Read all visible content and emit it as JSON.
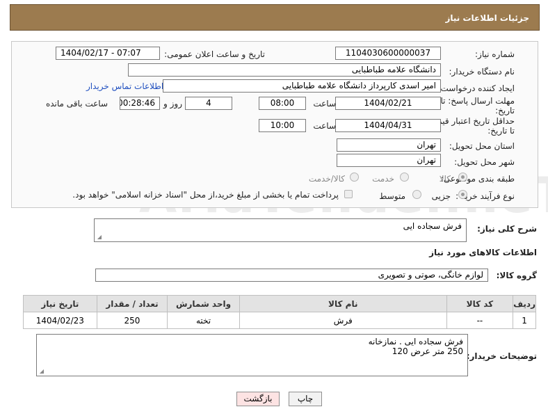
{
  "header": {
    "title": "جزئیات اطلاعات نیاز"
  },
  "form": {
    "need_number_label": "شماره نیاز:",
    "need_number": "1104030600000037",
    "announce_label": "تاریخ و ساعت اعلان عمومی:",
    "announce_value": "1404/02/17 - 07:07",
    "buyer_org_label": "نام دستگاه خریدار:",
    "buyer_org": "دانشگاه علامه طباطبایی",
    "requester_label": "ایجاد کننده درخواست:",
    "requester": "امیر اسدی کارپرداز دانشگاه علامه طباطبایی",
    "contact_link": "اطلاعات تماس خریدار",
    "deadline_label_1": "مهلت ارسال پاسخ: تا",
    "deadline_label_2": "تاریخ:",
    "deadline_date": "1404/02/21",
    "time_label": "ساعت",
    "deadline_time": "08:00",
    "days": "4",
    "days_label": "روز و",
    "remaining": "00:28:46",
    "remaining_label": "ساعت باقی مانده",
    "validity_label_1": "حداقل تاریخ اعتبار قیمت:",
    "validity_label_2": "تا تاریخ:",
    "validity_date": "1404/04/31",
    "validity_time": "10:00",
    "province_label": "استان محل تحویل:",
    "province": "تهران",
    "city_label": "شهر محل تحویل:",
    "city": "تهران",
    "category_label": "طبقه بندی موضوعی:",
    "category_options": [
      "کالا",
      "خدمت",
      "کالا/خدمت"
    ],
    "process_label": "نوع فرآیند خرید :",
    "process_options": [
      "جزیی",
      "متوسط"
    ],
    "payment_note": "پرداخت تمام یا بخشی از مبلغ خرید،از محل \"اسناد خزانه اسلامی\" خواهد بود."
  },
  "description": {
    "label": "شرح کلی نیاز:",
    "value": "فرش سجاده ایی"
  },
  "goods": {
    "section_title": "اطلاعات کالاهای مورد نیاز",
    "group_label": "گروه کالا:",
    "group_value": "لوازم خانگی، صوتی و تصویری",
    "columns": [
      "ردیف",
      "کد کالا",
      "نام کالا",
      "واحد شمارش",
      "تعداد / مقدار",
      "تاریخ نیاز"
    ],
    "rows": [
      [
        "1",
        "--",
        "فرش",
        "تخته",
        "250",
        "1404/02/23"
      ]
    ]
  },
  "buyer_notes": {
    "label": "توضیحات خریدار:",
    "line1": "فرش سجاده ایی . نمازخانه",
    "line2": "250 متر عرض 120"
  },
  "buttons": {
    "print": "چاپ",
    "back": "بازگشت"
  },
  "watermark": "AriaTender.neT",
  "colors": {
    "header_bg": "#9c7b4f",
    "link": "#1f4fbf",
    "back_button_bg": "#fde3e3"
  }
}
